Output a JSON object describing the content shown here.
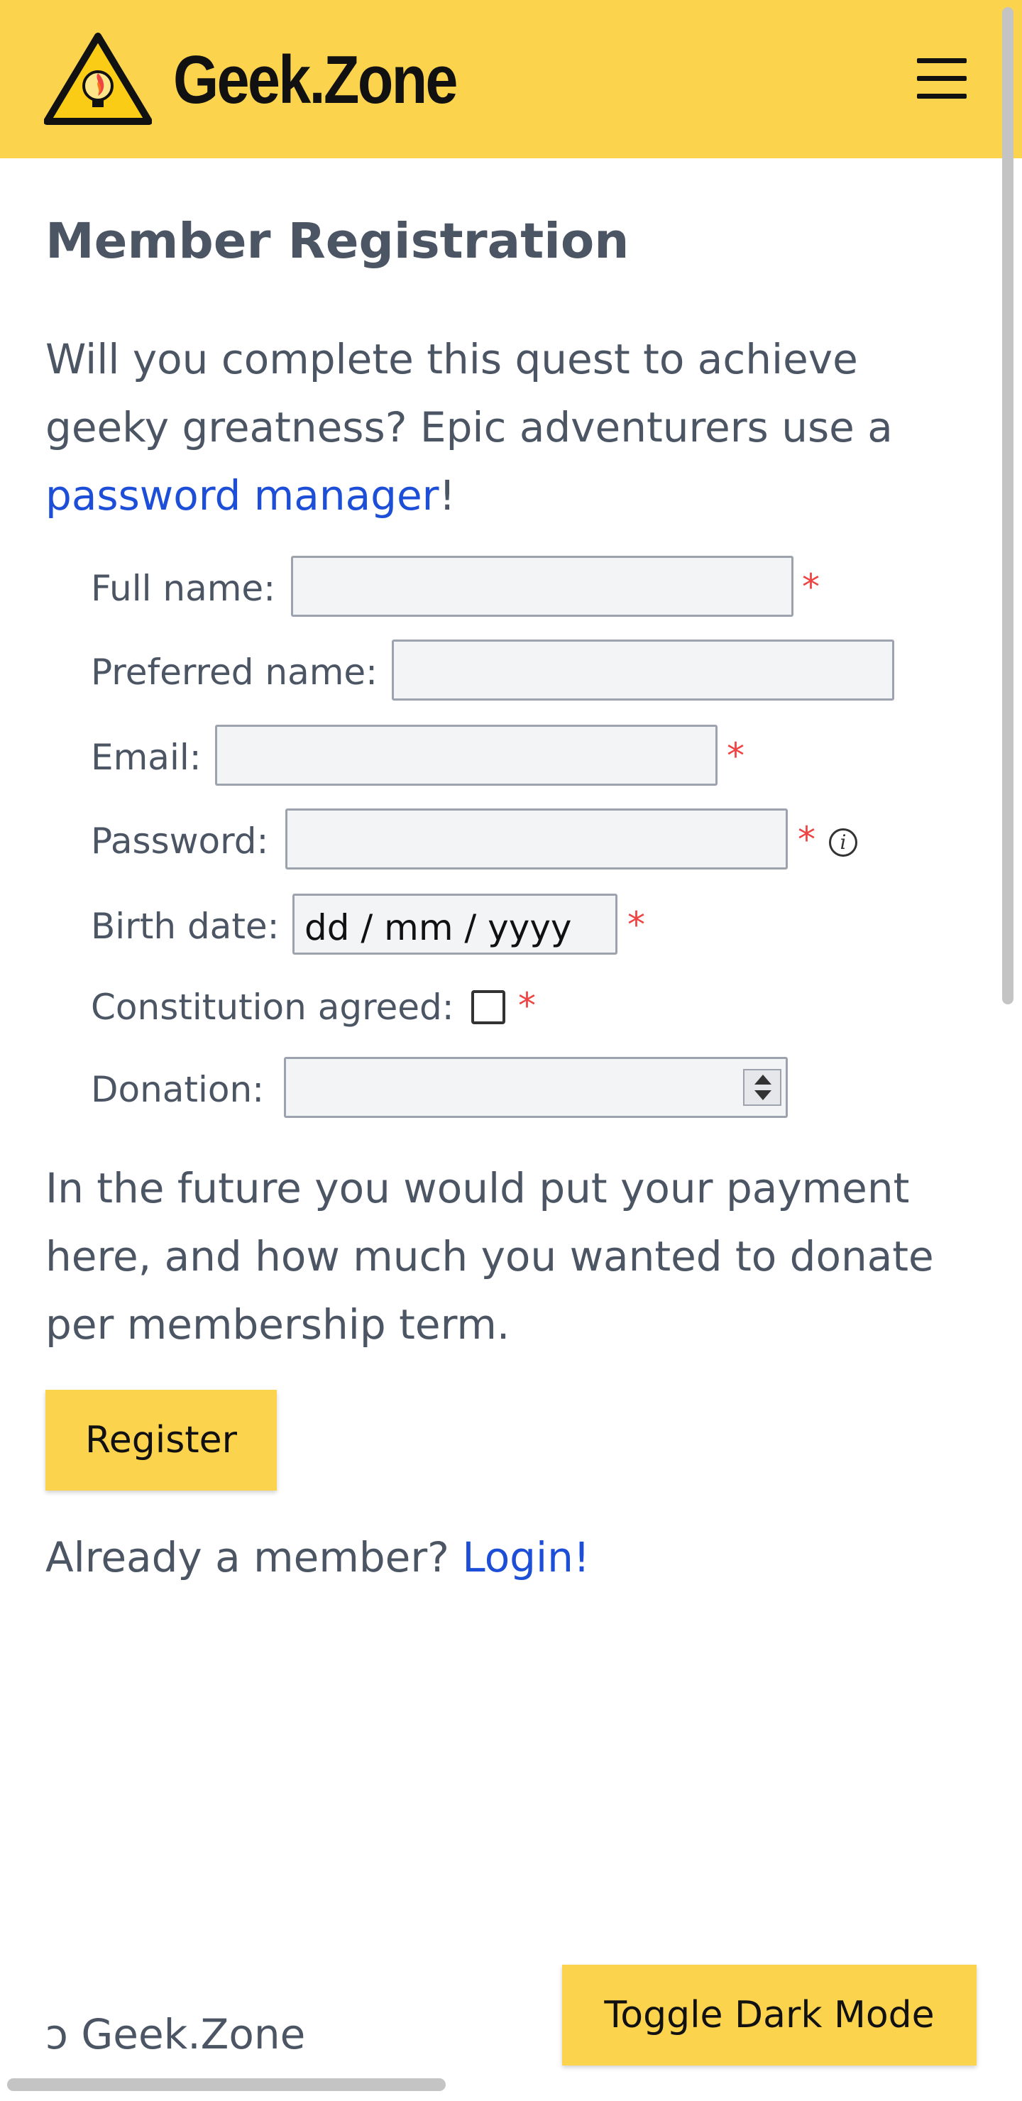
{
  "header": {
    "brand": "Geek.Zone",
    "logo_icon": "warning-lightbulb-flame-icon",
    "menu_icon": "hamburger-menu-icon",
    "background": "#fcd34d"
  },
  "page": {
    "title": "Member Registration",
    "intro_text": "Will you complete this quest to achieve geeky greatness? Epic adventurers use a ",
    "intro_link": "password manager",
    "intro_suffix": "!"
  },
  "form": {
    "full_name_label": "Full name:",
    "full_name_value": "",
    "preferred_name_label": "Preferred name:",
    "preferred_name_value": "",
    "email_label": "Email:",
    "email_value": "",
    "password_label": "Password:",
    "password_value": "",
    "password_info_icon": "info-icon",
    "birth_date_label": "Birth date:",
    "birth_date_placeholder": "dd / mm / yyyy",
    "constitution_label": "Constitution agreed:",
    "constitution_checked": false,
    "donation_label": "Donation:",
    "donation_value": "",
    "required_marker": "*"
  },
  "note": "In the future you would put your payment here, and how much you wanted to donate per membership term.",
  "register_label": "Register",
  "login": {
    "prompt": "Already a member? ",
    "link": "Login!"
  },
  "footer": {
    "copyright_icon": "copyleft-icon",
    "symbol": "ↄ",
    "text": "Geek.Zone",
    "dark_mode_label": "Toggle Dark Mode"
  },
  "colors": {
    "accent": "#fcd34d",
    "link": "#1d4ed8",
    "required": "#ef4444",
    "text": "#4b5563"
  }
}
